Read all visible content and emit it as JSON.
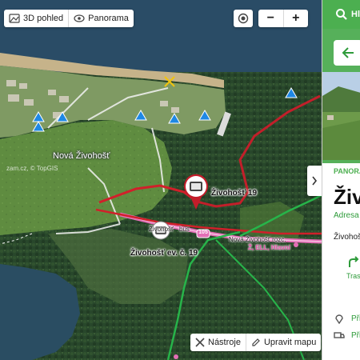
{
  "map": {
    "view_3d_label": "3D pohled",
    "panorama_label": "Panorama",
    "zoom_out": "−",
    "zoom_in": "+",
    "tools_label": "Nástroje",
    "edit_map_label": "Upravit mapu",
    "attribution": "zam.cz, © TopGIS",
    "area_label": "Nová Živohošť",
    "pins": [
      {
        "label": "Živohošť 19"
      },
      {
        "label": "Živohošť ev. č. 19"
      }
    ],
    "road_labels": {
      "bus": "bus",
      "crossing": "Nová Živohošť rozc.",
      "trail_prefix": "Živohošť"
    },
    "pink_label": "Ž, ELL, Hlavní",
    "road_badges": [
      "105"
    ],
    "colors": {
      "route_red": "#d0202a",
      "trail_green": "#27b44a",
      "road_pink": "#e36fb6",
      "water": "#2a4f6b",
      "meadow": "#5f8a3f",
      "forest": "#25452a"
    }
  },
  "panel": {
    "search_label": "Hl",
    "back_icon": "arrow-left-icon",
    "category": "PANORA",
    "title": "Živ",
    "subtitle": "Adresa",
    "address_line": "Živohošť",
    "route_label": "Tras",
    "row1_label": "Při",
    "row2_label": "Při",
    "colors": {
      "brand": "#4caf50",
      "accent": "#2e9b3a"
    }
  }
}
